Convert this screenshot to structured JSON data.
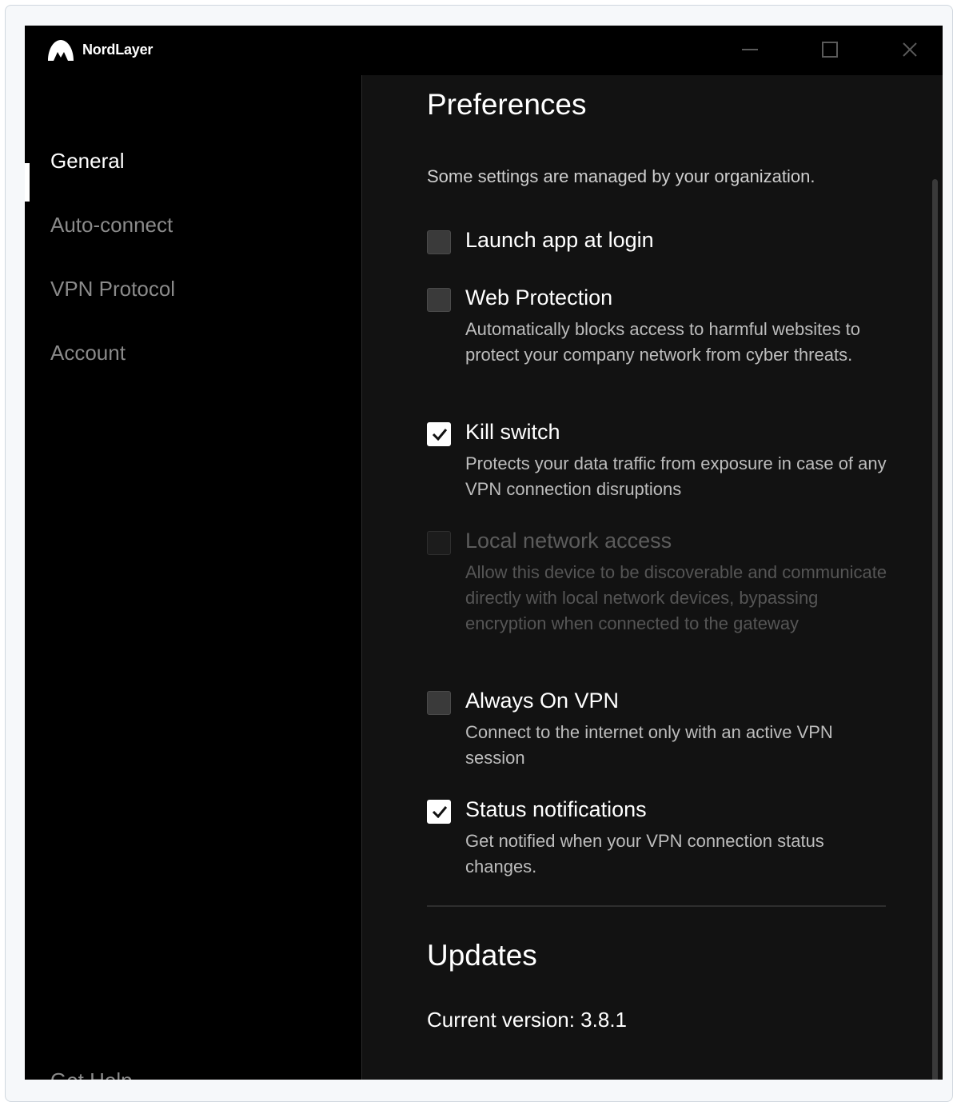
{
  "app": {
    "name": "NordLayer"
  },
  "sidebar": {
    "items": [
      {
        "label": "General",
        "active": true
      },
      {
        "label": "Auto-connect",
        "active": false
      },
      {
        "label": "VPN Protocol",
        "active": false
      },
      {
        "label": "Account",
        "active": false
      }
    ],
    "help_label": "Get Help"
  },
  "preferences": {
    "title": "Preferences",
    "notice": "Some settings are managed by your organization.",
    "settings": [
      {
        "label": "Launch app at login",
        "description": "",
        "checked": false,
        "disabled": false
      },
      {
        "label": "Web Protection",
        "description": "Automatically blocks access to harmful websites to protect your company network from cyber threats.",
        "checked": false,
        "disabled": false
      },
      {
        "label": "Kill switch",
        "description": "Protects your data traffic from exposure in case of any VPN connection disruptions",
        "checked": true,
        "disabled": false
      },
      {
        "label": "Local network access",
        "description": "Allow this device to be discoverable and communicate directly with local network devices, bypassing encryption when connected to the gateway",
        "checked": false,
        "disabled": true
      },
      {
        "label": "Always On VPN",
        "description": "Connect to the internet only with an active VPN session",
        "checked": false,
        "disabled": false
      },
      {
        "label": "Status notifications",
        "description": "Get notified when your VPN connection status changes.",
        "checked": true,
        "disabled": false
      }
    ]
  },
  "updates": {
    "title": "Updates",
    "current_version": "Current version: 3.8.1"
  },
  "colors": {
    "window_bg": "#111111",
    "sidebar_bg": "#000000",
    "accent": "#ffffff"
  }
}
